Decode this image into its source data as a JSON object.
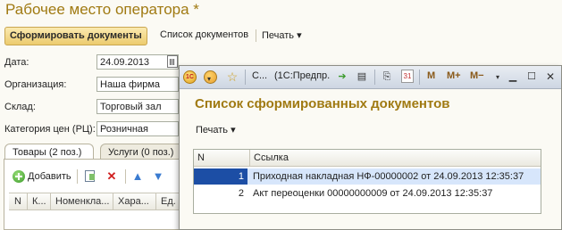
{
  "main": {
    "title": "Рабочее место оператора *",
    "toolbar": {
      "generate_label": "Сформировать документы",
      "documents_label": "Список документов",
      "print_label": "Печать",
      "print_arrow": "▾"
    },
    "fields": {
      "date_label": "Дата:",
      "date_value": "24.09.2013",
      "org_label": "Организация:",
      "org_value": "Наша фирма",
      "warehouse_label": "Склад:",
      "warehouse_value": "Торговый зал",
      "price_label": "Категория цен (РЦ):",
      "price_value": "Розничная"
    },
    "tabs": [
      {
        "label": "Товары (2 поз.)"
      },
      {
        "label": "Услуги (0 поз.)"
      }
    ],
    "table_toolbar": {
      "add_label": "Добавить"
    },
    "table_headers": [
      "N",
      "К...",
      "Номенкла...",
      "Хара...",
      "Ед."
    ]
  },
  "popup": {
    "titlebar": {
      "tab_short": "С...",
      "app_text": "(1С:Предпр.",
      "m_label": "M",
      "m_plus_label": "M+",
      "m_minus_label": "M−"
    },
    "heading": "Список сформированных документов",
    "print_label": "Печать",
    "print_arrow": "▾",
    "columns": [
      "N",
      "Ссылка"
    ],
    "rows": [
      {
        "n": "1",
        "link": "Приходная накладная НФ-00000002 от 24.09.2013 12:35:37"
      },
      {
        "n": "2",
        "link": "Акт переоценки 00000000009 от 24.09.2013 12:35:37"
      }
    ]
  },
  "colors": {
    "title_gold": "#a07a12",
    "selection_blue": "#1c4ea5",
    "selection_light": "#d7e6fb"
  }
}
